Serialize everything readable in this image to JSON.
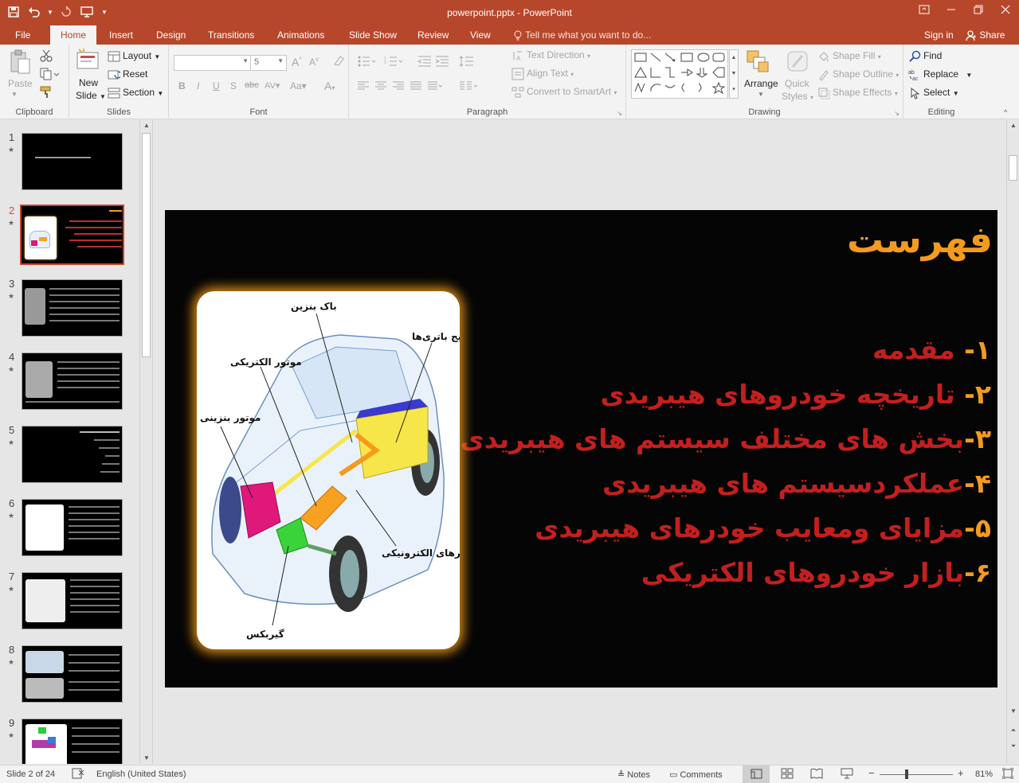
{
  "window": {
    "title": "powerpoint.pptx - PowerPoint",
    "colors": {
      "accent": "#b7472a",
      "ribbon_bg": "#f3f3f3",
      "slide_bg": "#050505",
      "title_orange": "#f29b1f",
      "text_red": "#c41f1f"
    }
  },
  "qat": {
    "save_icon": "save-icon",
    "undo_icon": "undo-icon",
    "redo_icon": "redo-icon",
    "present_icon": "present-icon",
    "customize_icon": "customize-icon"
  },
  "tabs": [
    "File",
    "Home",
    "Insert",
    "Design",
    "Transitions",
    "Animations",
    "Slide Show",
    "Review",
    "View"
  ],
  "active_tab": "Home",
  "tell_me": "Tell me what you want to do...",
  "account": {
    "sign_in": "Sign in",
    "share": "Share"
  },
  "ribbon": {
    "clipboard": {
      "label": "Clipboard",
      "paste": "Paste"
    },
    "slides": {
      "label": "Slides",
      "new_slide": "New",
      "new_slide_2": "Slide",
      "layout": "Layout",
      "reset": "Reset",
      "section": "Section"
    },
    "font": {
      "label": "Font",
      "font_name": "",
      "font_size": "5"
    },
    "paragraph": {
      "label": "Paragraph",
      "text_direction": "Text Direction",
      "align_text": "Align Text",
      "convert_smartart": "Convert to SmartArt"
    },
    "drawing": {
      "label": "Drawing",
      "arrange": "Arrange",
      "quick_styles": "Quick",
      "quick_styles_2": "Styles",
      "shape_fill": "Shape Fill",
      "shape_outline": "Shape Outline",
      "shape_effects": "Shape Effects"
    },
    "editing": {
      "label": "Editing",
      "find": "Find",
      "replace": "Replace",
      "select": "Select"
    }
  },
  "thumbnails": [
    {
      "num": "1"
    },
    {
      "num": "2"
    },
    {
      "num": "3"
    },
    {
      "num": "4"
    },
    {
      "num": "5"
    },
    {
      "num": "6"
    },
    {
      "num": "7"
    },
    {
      "num": "8"
    },
    {
      "num": "9"
    }
  ],
  "active_slide_index": 2,
  "slide": {
    "title": "فهرست",
    "items": [
      {
        "n": "۱-",
        "text": " مقدمه"
      },
      {
        "n": "۲-",
        "text": " تاریخچه خودروهای هیبریدی"
      },
      {
        "n": "۳-",
        "text": "بخش های مختلف سیستم های هیبریدی"
      },
      {
        "n": "۴-",
        "text": "عملکردسیستم های هیبریدی"
      },
      {
        "n": "۵-",
        "text": "مزایای ومعایب خودرهای هیبریدی"
      },
      {
        "n": "۶-",
        "text": "بازار خودروهای الکتریکی"
      }
    ],
    "car_labels": {
      "fuel_tank": "باک بنزین",
      "battery_pack": "پکیج باتری‌ها",
      "electric_motor": "موتور الکتریکی",
      "gas_engine": "موتور بنزینی",
      "electronics": "مدارهای الکترونیکی",
      "gearbox": "گیربکس"
    }
  },
  "status": {
    "slide_of": "Slide 2 of 24",
    "language": "English (United States)",
    "notes": "Notes",
    "comments": "Comments",
    "zoom": "81%"
  }
}
